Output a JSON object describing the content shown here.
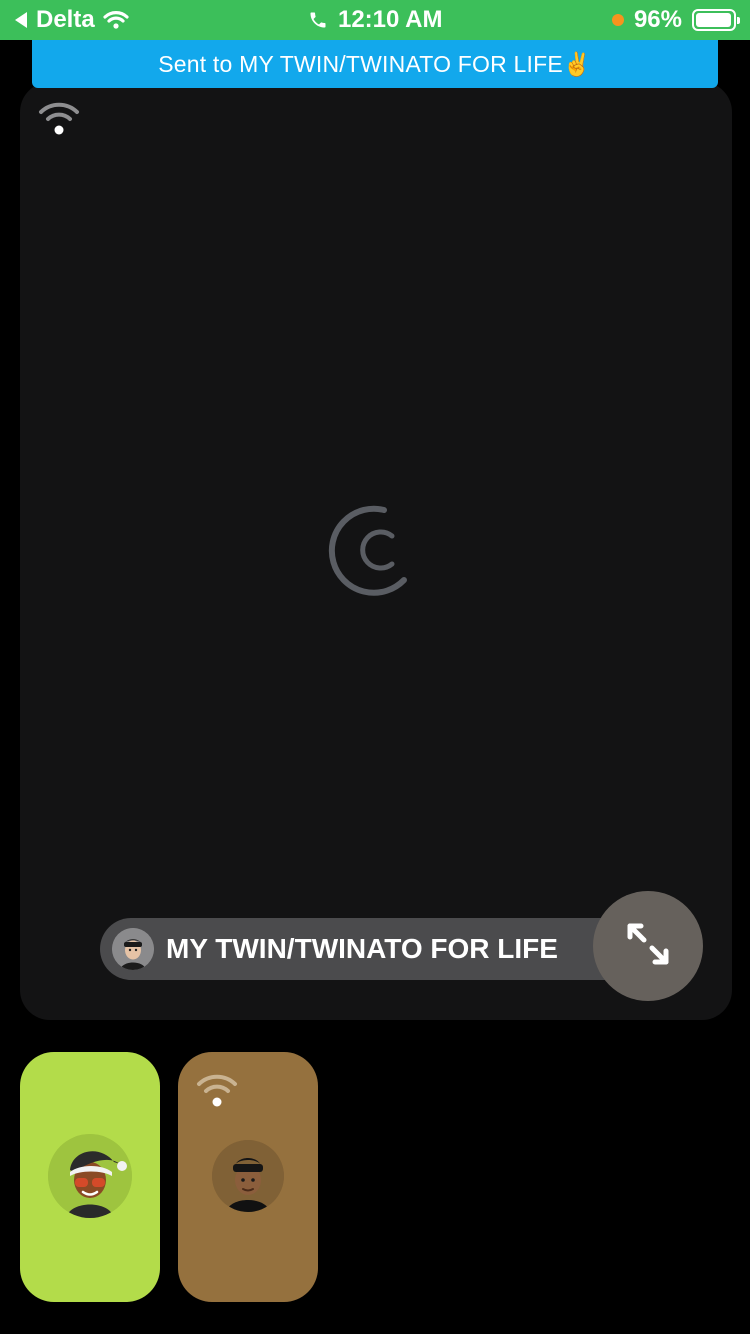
{
  "status_bar": {
    "carrier": "Delta",
    "time": "12:10 AM",
    "battery_percent": "96%",
    "battery_level": 0.96,
    "background_color": "#3cbf5a",
    "icons": [
      "back-arrow-icon",
      "wifi-icon",
      "phone-icon",
      "orange-dot-indicator",
      "battery-icon"
    ]
  },
  "banner": {
    "text": "Sent to MY TWIN/TWINATO FOR LIFE✌️",
    "color": "#12a8ec"
  },
  "main_call": {
    "participant_name": "MY TWIN/TWINATO FOR LIFE",
    "avatar": "bitmoji-avatar-cap",
    "connection_icon": "wifi-signal-icon",
    "loading": true,
    "expand_icon": "expand-arrows-icon",
    "background_color": "#131314"
  },
  "thumbnails": [
    {
      "avatar": "bitmoji-avatar-santa-hat",
      "color": "#b3dc4a"
    },
    {
      "avatar": "bitmoji-avatar-cap",
      "color": "#95713e",
      "connection_icon": "wifi-signal-icon"
    }
  ]
}
